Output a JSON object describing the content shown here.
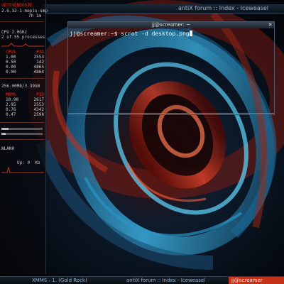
{
  "wallpaper": {
    "colors": {
      "bg": "#020306",
      "blue": "#1e7fb0",
      "cyan": "#5fd9ff",
      "red": "#b3261a"
    }
  },
  "browser_window": {
    "title": "antiX forum :: Index - Iceweasel"
  },
  "conky": {
    "hostname": "VETEVENDOSJE",
    "kernel": "2.6.32-1-mepis-smp",
    "uptime": "7h 1m",
    "cpu_line": "CPU 2.0GHz",
    "processes": "2 of 55 processes",
    "cpu_table": {
      "headers": [
        "CPU%",
        "PID"
      ],
      "rows": [
        [
          "1.00",
          "2553"
        ],
        [
          "0.50",
          "142"
        ],
        [
          "0.00",
          "4865"
        ],
        [
          "0.00",
          "4864"
        ]
      ]
    },
    "memory_line": "256.00MB/3.39GB",
    "mem_table": {
      "headers": [
        "MEM%",
        "PID"
      ],
      "rows": [
        [
          "10.98",
          "2617"
        ],
        [
          "2.95",
          "2553"
        ],
        [
          "0.76",
          "4342"
        ],
        [
          "0.47",
          "2598"
        ]
      ]
    },
    "net_label": "WLAN0",
    "net_sub": "Up: 0  Kb"
  },
  "terminal": {
    "title": "jj@screamer: ~",
    "prompt": "jj@screamer:~$ ",
    "command": "scrot -d desktop.png"
  },
  "taskbar": {
    "items": [
      {
        "label": "XMMS - 1. (Gold Rock)",
        "active": false
      },
      {
        "label": "antiX forum :: Index - Iceweasel",
        "active": false
      },
      {
        "label": "jj@screamer",
        "active": true
      }
    ]
  }
}
